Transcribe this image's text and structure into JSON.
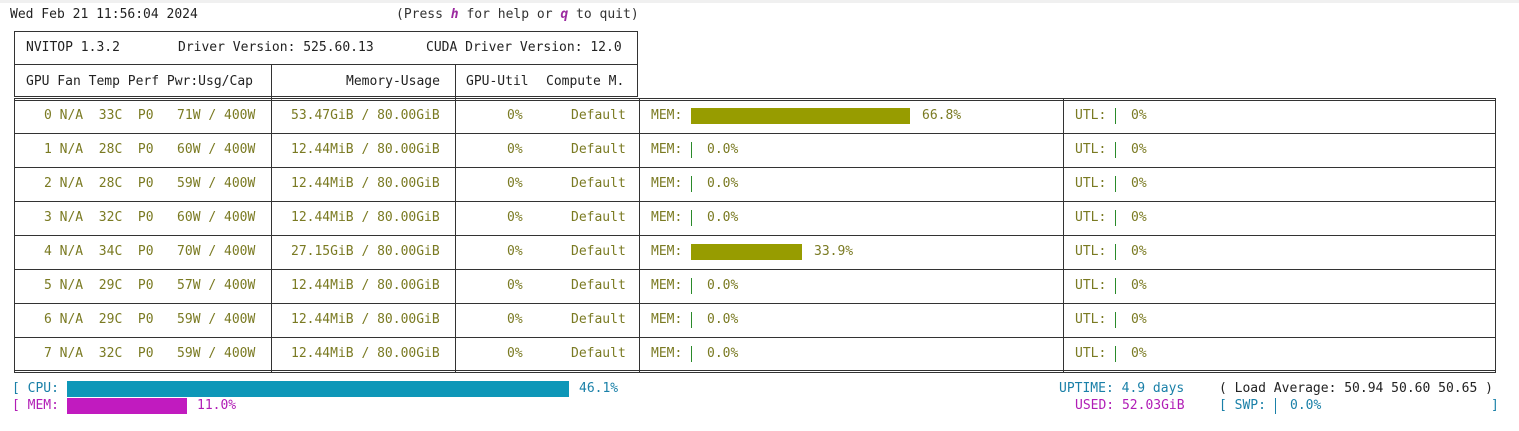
{
  "header": {
    "datetime": "Wed Feb 21 11:56:04 2024",
    "help_pre": "(Press ",
    "help_key1": "h",
    "help_mid": " for help or ",
    "help_key2": "q",
    "help_post": " to quit)"
  },
  "info": {
    "nvitop": "NVITOP 1.3.2",
    "driver": "Driver Version: 525.60.13",
    "cuda": "CUDA Driver Version: 12.0"
  },
  "columns": {
    "c1": "GPU Fan Temp Perf Pwr:Usg/Cap",
    "c2": "Memory-Usage",
    "c3": "GPU-Util",
    "c4": "Compute M."
  },
  "mem_label": "MEM:",
  "utl_label": "UTL:",
  "gpus": [
    {
      "stats": "0 N/A  33C  P0   71W / 400W",
      "memory": "53.47GiB / 80.00GiB",
      "util": "0%",
      "mode": "Default",
      "mem_pct": 66.8,
      "mem_pct_text": "66.8%",
      "utl": "0%",
      "active": true
    },
    {
      "stats": "1 N/A  28C  P0   60W / 400W",
      "memory": "12.44MiB / 80.00GiB",
      "util": "0%",
      "mode": "Default",
      "mem_pct": 0.0,
      "mem_pct_text": "0.0%",
      "utl": "0%",
      "active": false
    },
    {
      "stats": "2 N/A  28C  P0   59W / 400W",
      "memory": "12.44MiB / 80.00GiB",
      "util": "0%",
      "mode": "Default",
      "mem_pct": 0.0,
      "mem_pct_text": "0.0%",
      "utl": "0%",
      "active": false
    },
    {
      "stats": "3 N/A  32C  P0   60W / 400W",
      "memory": "12.44MiB / 80.00GiB",
      "util": "0%",
      "mode": "Default",
      "mem_pct": 0.0,
      "mem_pct_text": "0.0%",
      "utl": "0%",
      "active": false
    },
    {
      "stats": "4 N/A  34C  P0   70W / 400W",
      "memory": "27.15GiB / 80.00GiB",
      "util": "0%",
      "mode": "Default",
      "mem_pct": 33.9,
      "mem_pct_text": "33.9%",
      "utl": "0%",
      "active": true
    },
    {
      "stats": "5 N/A  29C  P0   57W / 400W",
      "memory": "12.44MiB / 80.00GiB",
      "util": "0%",
      "mode": "Default",
      "mem_pct": 0.0,
      "mem_pct_text": "0.0%",
      "utl": "0%",
      "active": false
    },
    {
      "stats": "6 N/A  29C  P0   59W / 400W",
      "memory": "12.44MiB / 80.00GiB",
      "util": "0%",
      "mode": "Default",
      "mem_pct": 0.0,
      "mem_pct_text": "0.0%",
      "utl": "0%",
      "active": false
    },
    {
      "stats": "7 N/A  32C  P0   59W / 400W",
      "memory": "12.44MiB / 80.00GiB",
      "util": "0%",
      "mode": "Default",
      "mem_pct": 0.0,
      "mem_pct_text": "0.0%",
      "utl": "0%",
      "active": false
    }
  ],
  "host": {
    "cpu_label": "[ CPU:",
    "cpu_pct": 46.1,
    "cpu_pct_text": "46.1%",
    "mem_label": "[ MEM:",
    "mem_pct": 11.0,
    "mem_pct_text": "11.0%",
    "uptime": "UPTIME: 4.9 days",
    "load_avg": "( Load Average: 50.94 50.60 50.65 )",
    "used": "USED: 52.03GiB",
    "swp_label": "[ SWP:",
    "swp_value": "0.0%",
    "swp_close": "]"
  },
  "colors": {
    "bar_olive": "#979c00",
    "bar_cpu": "#0e97b8",
    "bar_mem": "#c11bbf",
    "text_green": "#2a8a2a",
    "text_olive": "#7a7a22"
  }
}
